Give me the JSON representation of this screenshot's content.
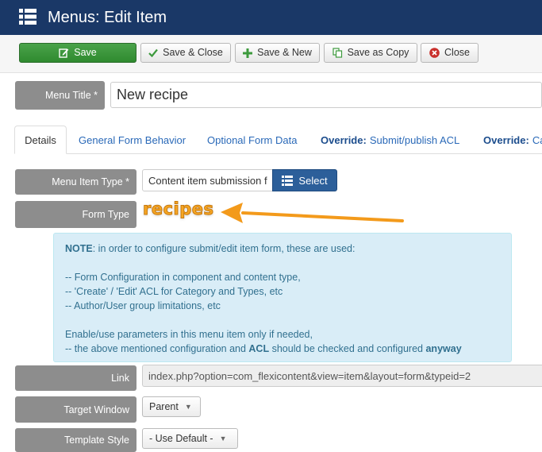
{
  "header": {
    "title": "Menus: Edit Item"
  },
  "toolbar": {
    "save_label": "Save",
    "save_close_label": "Save & Close",
    "save_new_label": "Save & New",
    "save_copy_label": "Save as Copy",
    "close_label": "Close"
  },
  "menu_title": {
    "label": "Menu Title *",
    "value": "New recipe"
  },
  "tabs": [
    {
      "label": "Details"
    },
    {
      "label": "General Form Behavior"
    },
    {
      "label": "Optional Form Data"
    },
    {
      "prefix": "Override:",
      "label": "Submit/publish ACL"
    },
    {
      "prefix": "Override:",
      "label": "Ca"
    }
  ],
  "menu_item_type": {
    "label": "Menu Item Type *",
    "value": "Content item submission f",
    "select_label": "Select"
  },
  "form_type": {
    "label": "Form Type",
    "value": "recipes"
  },
  "note": {
    "line1_bold": "NOTE",
    "line1": ": in order to configure submit/edit item form, these are used:",
    "items": [
      "-- Form Configuration in component and content type,",
      "-- 'Create' / 'Edit' ACL for Category and Types, etc",
      "-- Author/User group limitations, etc"
    ],
    "line5": "Enable/use parameters in this menu item only if needed,",
    "line6_a": "-- the above mentioned configuration and ",
    "line6_acl": "ACL",
    "line6_b": " should be checked and configured ",
    "line6_anyway": "anyway"
  },
  "link": {
    "label": "Link",
    "value": "index.php?option=com_flexicontent&view=item&layout=form&typeid=2"
  },
  "target_window": {
    "label": "Target Window",
    "value": "Parent"
  },
  "template_style": {
    "label": "Template Style",
    "value": "- Use Default -"
  },
  "colors": {
    "header_bg": "#1a3867",
    "save_green": "#3d9a3d",
    "label_gray": "#8d8d8d",
    "note_bg": "#d9edf7",
    "accent_orange": "#f6a623"
  }
}
